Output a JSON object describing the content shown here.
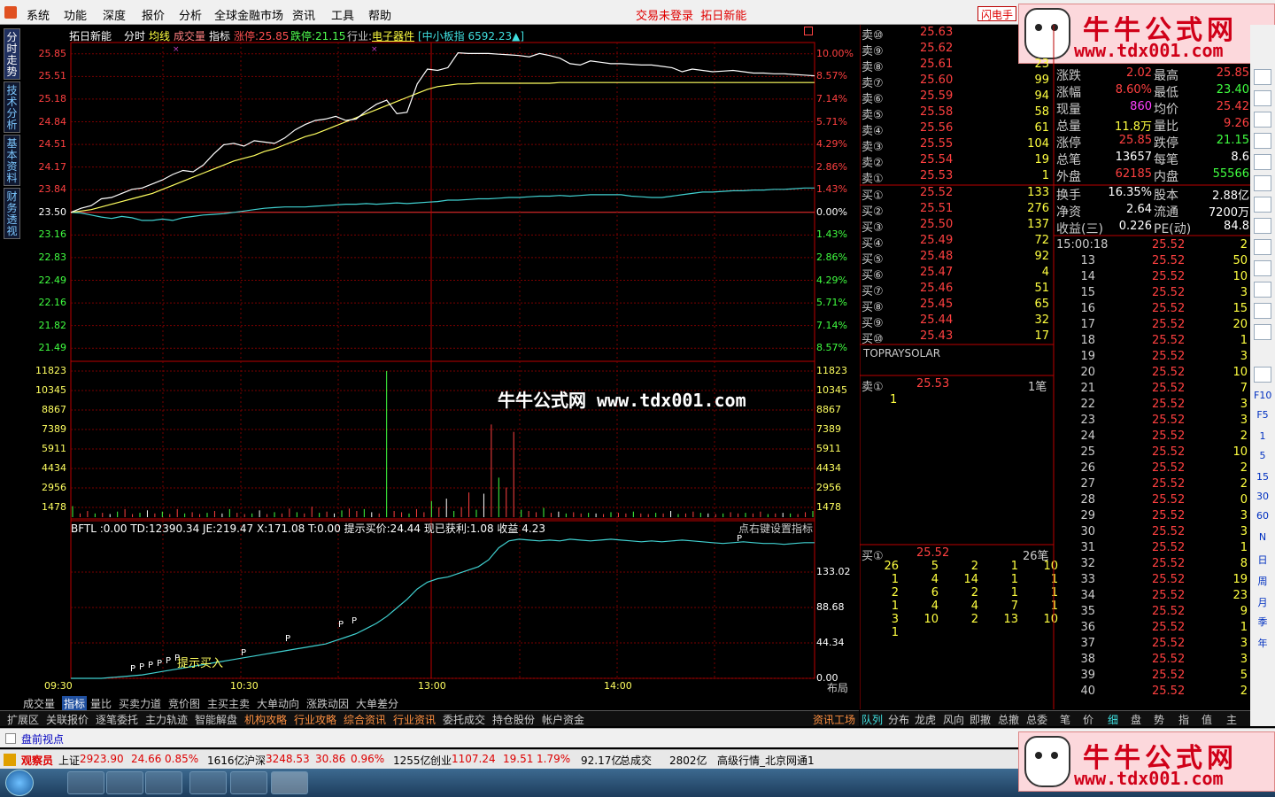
{
  "menu": [
    "系统",
    "功能",
    "深度",
    "报价",
    "分析",
    "全球金融市场",
    "资讯",
    "工具",
    "帮助"
  ],
  "login_status": "交易未登录",
  "stock_name": "拓日新能",
  "flash_button": "闪电手",
  "watermark": {
    "title": "牛牛公式网",
    "url": "www.tdx001.com"
  },
  "chart_watermark": "牛牛公式网 www.tdx001.com",
  "left_tabs": [
    "分时走势",
    "技术分析",
    "基本资料",
    "财务透视"
  ],
  "chart_header": {
    "name": "拓日新能",
    "tab_fenshi": "分时",
    "tab_junxian": "均线",
    "tab_chengjiaoliang": "成交量",
    "tab_zhibiao": "指标",
    "limit_up": "涨停:25.85",
    "limit_down": "跌停:21.15",
    "industry_label": "行业:",
    "industry": "电子器件",
    "index_info": "[中小板指 6592.23▲]"
  },
  "price_axis": [
    "25.85",
    "25.51",
    "25.18",
    "24.84",
    "24.51",
    "24.17",
    "23.84",
    "23.50",
    "23.16",
    "22.83",
    "22.49",
    "22.16",
    "21.82",
    "21.49"
  ],
  "pct_axis": [
    "10.00%",
    "8.57%",
    "7.14%",
    "5.71%",
    "4.29%",
    "2.86%",
    "1.43%",
    "0.00%",
    "1.43%",
    "2.86%",
    "4.29%",
    "5.71%",
    "7.14%",
    "8.57%"
  ],
  "volume_axis": [
    "11823",
    "10345",
    "8867",
    "7389",
    "5911",
    "4434",
    "2956",
    "1478"
  ],
  "indicator_axis": [
    "133.02",
    "88.68",
    "44.34",
    "0.00"
  ],
  "indicator_header": "BFTL  :0.00  TD:12390.34  JE:219.47  X:171.08  T:0.00  提示买价:24.44  现已获利:1.08  收益 4.23",
  "indicator_hint": "点右键设置指标",
  "buy_signal_label": "提示买入",
  "signal_marker": "P",
  "time_axis": [
    "09:30",
    "10:30",
    "13:00",
    "14:00"
  ],
  "layout_label": "布局",
  "bottom_tabs": [
    "成交量",
    "指标",
    "量比",
    "买卖力道",
    "竞价图",
    "主买主卖",
    "大单动向",
    "涨跌动因",
    "大单差分"
  ],
  "func_tabs": [
    "扩展区",
    "关联报价",
    "逐笔委托",
    "主力轨迹",
    "智能解盘",
    "机构攻略",
    "行业攻略",
    "综合资讯",
    "行业资讯",
    "委托成交",
    "持仓股份",
    "帐户资金"
  ],
  "func_tab_right": "资讯工场",
  "sell_book": [
    {
      "label": "卖⑩",
      "price": "25.63",
      "vol": ""
    },
    {
      "label": "卖⑨",
      "price": "25.62",
      "vol": ""
    },
    {
      "label": "卖⑧",
      "price": "25.61",
      "vol": "23"
    },
    {
      "label": "卖⑦",
      "price": "25.60",
      "vol": "99"
    },
    {
      "label": "卖⑥",
      "price": "25.59",
      "vol": "94"
    },
    {
      "label": "卖⑤",
      "price": "25.58",
      "vol": "58"
    },
    {
      "label": "卖④",
      "price": "25.56",
      "vol": "61"
    },
    {
      "label": "卖③",
      "price": "25.55",
      "vol": "104"
    },
    {
      "label": "卖②",
      "price": "25.54",
      "vol": "19"
    },
    {
      "label": "卖①",
      "price": "25.53",
      "vol": "1"
    }
  ],
  "buy_book": [
    {
      "label": "买①",
      "price": "25.52",
      "vol": "133"
    },
    {
      "label": "买②",
      "price": "25.51",
      "vol": "276"
    },
    {
      "label": "买③",
      "price": "25.50",
      "vol": "137"
    },
    {
      "label": "买④",
      "price": "25.49",
      "vol": "72"
    },
    {
      "label": "买⑤",
      "price": "25.48",
      "vol": "92"
    },
    {
      "label": "买⑥",
      "price": "25.47",
      "vol": "4"
    },
    {
      "label": "买⑦",
      "price": "25.46",
      "vol": "51"
    },
    {
      "label": "买⑧",
      "price": "25.45",
      "vol": "65"
    },
    {
      "label": "买⑨",
      "price": "25.44",
      "vol": "32"
    },
    {
      "label": "买⑩",
      "price": "25.43",
      "vol": "17"
    }
  ],
  "stats": [
    {
      "k1": "涨跌",
      "v1": "2.02",
      "c1": "#ff4040",
      "k2": "最高",
      "v2": "25.85",
      "c2": "#ff4040"
    },
    {
      "k1": "涨幅",
      "v1": "8.60%",
      "c1": "#ff4040",
      "k2": "最低",
      "v2": "23.40",
      "c2": "#40ff40"
    },
    {
      "k1": "现量",
      "v1": "860",
      "c1": "#ff40ff",
      "k2": "均价",
      "v2": "25.42",
      "c2": "#ff4040"
    },
    {
      "k1": "总量",
      "v1": "11.8万",
      "c1": "#ffff40",
      "k2": "量比",
      "v2": "9.26",
      "c2": "#ff4040"
    },
    {
      "k1": "涨停",
      "v1": "25.85",
      "c1": "#ff4040",
      "k2": "跌停",
      "v2": "21.15",
      "c2": "#40ff40"
    },
    {
      "k1": "总笔",
      "v1": "13657",
      "c1": "#ffffff",
      "k2": "每笔",
      "v2": "8.6",
      "c2": "#ffffff"
    },
    {
      "k1": "外盘",
      "v1": "62185",
      "c1": "#ff4040",
      "k2": "内盘",
      "v2": "55566",
      "c2": "#40ff40"
    },
    {
      "k1": "换手",
      "v1": "16.35%",
      "c1": "#ffffff",
      "k2": "股本",
      "v2": "2.88亿",
      "c2": "#ffffff"
    },
    {
      "k1": "净资",
      "v1": "2.64",
      "c1": "#ffffff",
      "k2": "流通",
      "v2": "7200万",
      "c2": "#ffffff"
    },
    {
      "k1": "收益(三)",
      "v1": "0.226",
      "c1": "#ffffff",
      "k2": "PE(动)",
      "v2": "84.8",
      "c2": "#ffffff"
    }
  ],
  "company_en": "TOPRAYSOLAR",
  "sell1_queue": {
    "label": "卖①",
    "price": "25.53",
    "count": "1笔",
    "items": [
      "1"
    ]
  },
  "buy1_queue": {
    "label": "买①",
    "price": "25.52",
    "count": "26笔",
    "items": [
      "26",
      "5",
      "2",
      "1",
      "10",
      "1",
      "4",
      "14",
      "1",
      "1",
      "2",
      "6",
      "2",
      "1",
      "1",
      "1",
      "4",
      "4",
      "7",
      "1",
      "3",
      "10",
      "2",
      "13",
      "10",
      "1"
    ]
  },
  "ticks_first_time": "15:00:18",
  "ticks": [
    {
      "t": "13",
      "p": "25.52",
      "v": "50"
    },
    {
      "t": "14",
      "p": "25.52",
      "v": "10"
    },
    {
      "t": "15",
      "p": "25.52",
      "v": "3"
    },
    {
      "t": "16",
      "p": "25.52",
      "v": "15"
    },
    {
      "t": "17",
      "p": "25.52",
      "v": "20"
    },
    {
      "t": "18",
      "p": "25.52",
      "v": "1"
    },
    {
      "t": "19",
      "p": "25.52",
      "v": "3"
    },
    {
      "t": "20",
      "p": "25.52",
      "v": "10"
    },
    {
      "t": "21",
      "p": "25.52",
      "v": "7"
    },
    {
      "t": "22",
      "p": "25.52",
      "v": "3"
    },
    {
      "t": "23",
      "p": "25.52",
      "v": "3"
    },
    {
      "t": "24",
      "p": "25.52",
      "v": "2"
    },
    {
      "t": "25",
      "p": "25.52",
      "v": "10"
    },
    {
      "t": "26",
      "p": "25.52",
      "v": "2"
    },
    {
      "t": "27",
      "p": "25.52",
      "v": "2"
    },
    {
      "t": "28",
      "p": "25.52",
      "v": "0"
    },
    {
      "t": "29",
      "p": "25.52",
      "v": "3"
    },
    {
      "t": "30",
      "p": "25.52",
      "v": "3"
    },
    {
      "t": "31",
      "p": "25.52",
      "v": "1"
    },
    {
      "t": "32",
      "p": "25.52",
      "v": "8"
    },
    {
      "t": "33",
      "p": "25.52",
      "v": "19"
    },
    {
      "t": "34",
      "p": "25.52",
      "v": "23"
    },
    {
      "t": "35",
      "p": "25.52",
      "v": "9"
    },
    {
      "t": "36",
      "p": "25.52",
      "v": "1"
    },
    {
      "t": "37",
      "p": "25.52",
      "v": "3"
    },
    {
      "t": "38",
      "p": "25.52",
      "v": "3"
    },
    {
      "t": "39",
      "p": "25.52",
      "v": "5"
    },
    {
      "t": "40",
      "p": "25.52",
      "v": "2"
    }
  ],
  "ticks_first_vol": "2",
  "right_bottom_tabs_a": [
    "队列",
    "分布",
    "龙虎",
    "风向",
    "即撤",
    "总撤",
    "总委"
  ],
  "right_bottom_tabs_b": [
    "笔",
    "价",
    "细",
    "盘",
    "势",
    "指",
    "值",
    "主"
  ],
  "right_toolbar": [
    "F10",
    "F5",
    "1",
    "5",
    "15",
    "30",
    "60",
    "N",
    "日",
    "周",
    "月",
    "季",
    "年"
  ],
  "status_hint": "盘前视点",
  "market_bar": {
    "watch": "观察员",
    "sh_label": "上证",
    "sh_val": "2923.90",
    "sh_chg": "24.66",
    "sh_pct": "0.85%",
    "sh_amt": "1616亿",
    "hs_label": "沪深",
    "hs_val": "3248.53",
    "hs_chg": "30.86",
    "hs_pct": "0.96%",
    "hs_amt": "1255亿",
    "cy_label": "创业",
    "cy_val": "1107.24",
    "cy_chg": "19.51",
    "cy_pct": "1.79%",
    "cy_amt": "92.17亿",
    "total_label": "总成交",
    "total_amt": "2802亿",
    "server": "高级行情_北京网通1"
  },
  "chart_data": {
    "type": "line",
    "prev_close": 23.5,
    "ylim": [
      21.15,
      25.85
    ],
    "price_series": [
      23.5,
      23.56,
      23.6,
      23.7,
      23.72,
      23.78,
      23.84,
      23.86,
      23.92,
      23.98,
      24.06,
      24.12,
      24.1,
      24.2,
      24.36,
      24.5,
      24.52,
      24.48,
      24.56,
      24.54,
      24.52,
      24.6,
      24.72,
      24.8,
      24.86,
      24.88,
      24.92,
      24.86,
      24.88,
      25.0,
      25.1,
      25.16,
      24.96,
      24.98,
      25.4,
      25.62,
      25.6,
      25.64,
      25.86,
      25.85,
      25.85,
      25.85,
      25.84,
      25.83,
      25.82,
      25.8,
      25.85,
      25.82,
      25.78,
      25.7,
      25.68,
      25.74,
      25.72,
      25.7,
      25.7,
      25.69,
      25.68,
      25.68,
      25.66,
      25.64,
      25.58,
      25.62,
      25.6,
      25.58,
      25.59,
      25.6,
      25.58,
      25.56,
      25.56,
      25.55,
      25.55,
      25.54,
      25.53,
      25.52
    ],
    "avg_series": [
      23.5,
      23.52,
      23.54,
      23.58,
      23.62,
      23.66,
      23.7,
      23.74,
      23.78,
      23.84,
      23.9,
      23.96,
      24.02,
      24.08,
      24.14,
      24.2,
      24.26,
      24.3,
      24.34,
      24.4,
      24.44,
      24.5,
      24.56,
      24.62,
      24.66,
      24.72,
      24.78,
      24.84,
      24.9,
      24.96,
      25.02,
      25.08,
      25.14,
      25.2,
      25.26,
      25.32,
      25.36,
      25.38,
      25.4,
      25.4,
      25.41,
      25.41,
      25.41,
      25.41,
      25.41,
      25.41,
      25.41,
      25.41,
      25.42,
      25.42,
      25.42,
      25.42,
      25.42,
      25.42,
      25.42,
      25.42,
      25.42,
      25.42,
      25.42,
      25.42,
      25.42,
      25.42,
      25.42,
      25.42,
      25.42,
      25.42,
      25.42,
      25.42,
      25.42,
      25.42,
      25.42,
      25.42,
      25.42,
      25.42
    ],
    "index_series": [
      23.5,
      23.49,
      23.46,
      23.43,
      23.41,
      23.44,
      23.42,
      23.38,
      23.38,
      23.4,
      23.38,
      23.42,
      23.44,
      23.46,
      23.47,
      23.48,
      23.5,
      23.52,
      23.54,
      23.56,
      23.57,
      23.58,
      23.58,
      23.58,
      23.59,
      23.6,
      23.61,
      23.62,
      23.62,
      23.63,
      23.62,
      23.63,
      23.64,
      23.63,
      23.64,
      23.65,
      23.66,
      23.68,
      23.68,
      23.69,
      23.7,
      23.7,
      23.71,
      23.72,
      23.72,
      23.73,
      23.74,
      23.74,
      23.75,
      23.74,
      23.75,
      23.76,
      23.76,
      23.76,
      23.76,
      23.74,
      23.73,
      23.72,
      23.72,
      23.74,
      23.76,
      23.78,
      23.8,
      23.8,
      23.81,
      23.82,
      23.82,
      23.83,
      23.83,
      23.84,
      23.84,
      23.85,
      23.86,
      23.86
    ],
    "volume_series": [
      900,
      300,
      500,
      300,
      350,
      250,
      450,
      650,
      250,
      350,
      550,
      300,
      450,
      250,
      650,
      300,
      400,
      250,
      350,
      500,
      300,
      650,
      350,
      250,
      300,
      550,
      250,
      400,
      300,
      700,
      400,
      300,
      850,
      350,
      450,
      300,
      550,
      700,
      500,
      650,
      400,
      300,
      11823,
      500,
      400,
      300,
      650,
      400,
      1300,
      800,
      1500,
      500,
      800,
      2000,
      600,
      1900,
      7500,
      3200,
      2400,
      6900,
      600,
      500,
      400,
      750,
      350,
      450,
      300,
      400,
      300,
      350,
      300,
      250,
      400,
      350,
      300,
      450,
      300,
      250,
      350,
      300,
      500,
      250,
      300,
      450,
      350,
      300,
      250,
      300,
      400,
      300,
      350,
      300,
      450,
      250,
      300,
      350,
      300,
      250,
      400,
      500
    ],
    "indicator_series": [
      0,
      0,
      0,
      0,
      1,
      2,
      3,
      4,
      6,
      8,
      10,
      12,
      14,
      16,
      18,
      20,
      22,
      24,
      26,
      28,
      30,
      32,
      34,
      36,
      38,
      40,
      44,
      48,
      52,
      58,
      64,
      72,
      82,
      92,
      104,
      112,
      116,
      118,
      122,
      126,
      130,
      138,
      152,
      160,
      162,
      161,
      160,
      161,
      160,
      162,
      161,
      160,
      161,
      162,
      161,
      160,
      159,
      160,
      159,
      160,
      161,
      160,
      159,
      158,
      157,
      158,
      159,
      158,
      157,
      157,
      156,
      157,
      158,
      158
    ],
    "indicator_ylim": [
      0,
      177.36
    ]
  }
}
